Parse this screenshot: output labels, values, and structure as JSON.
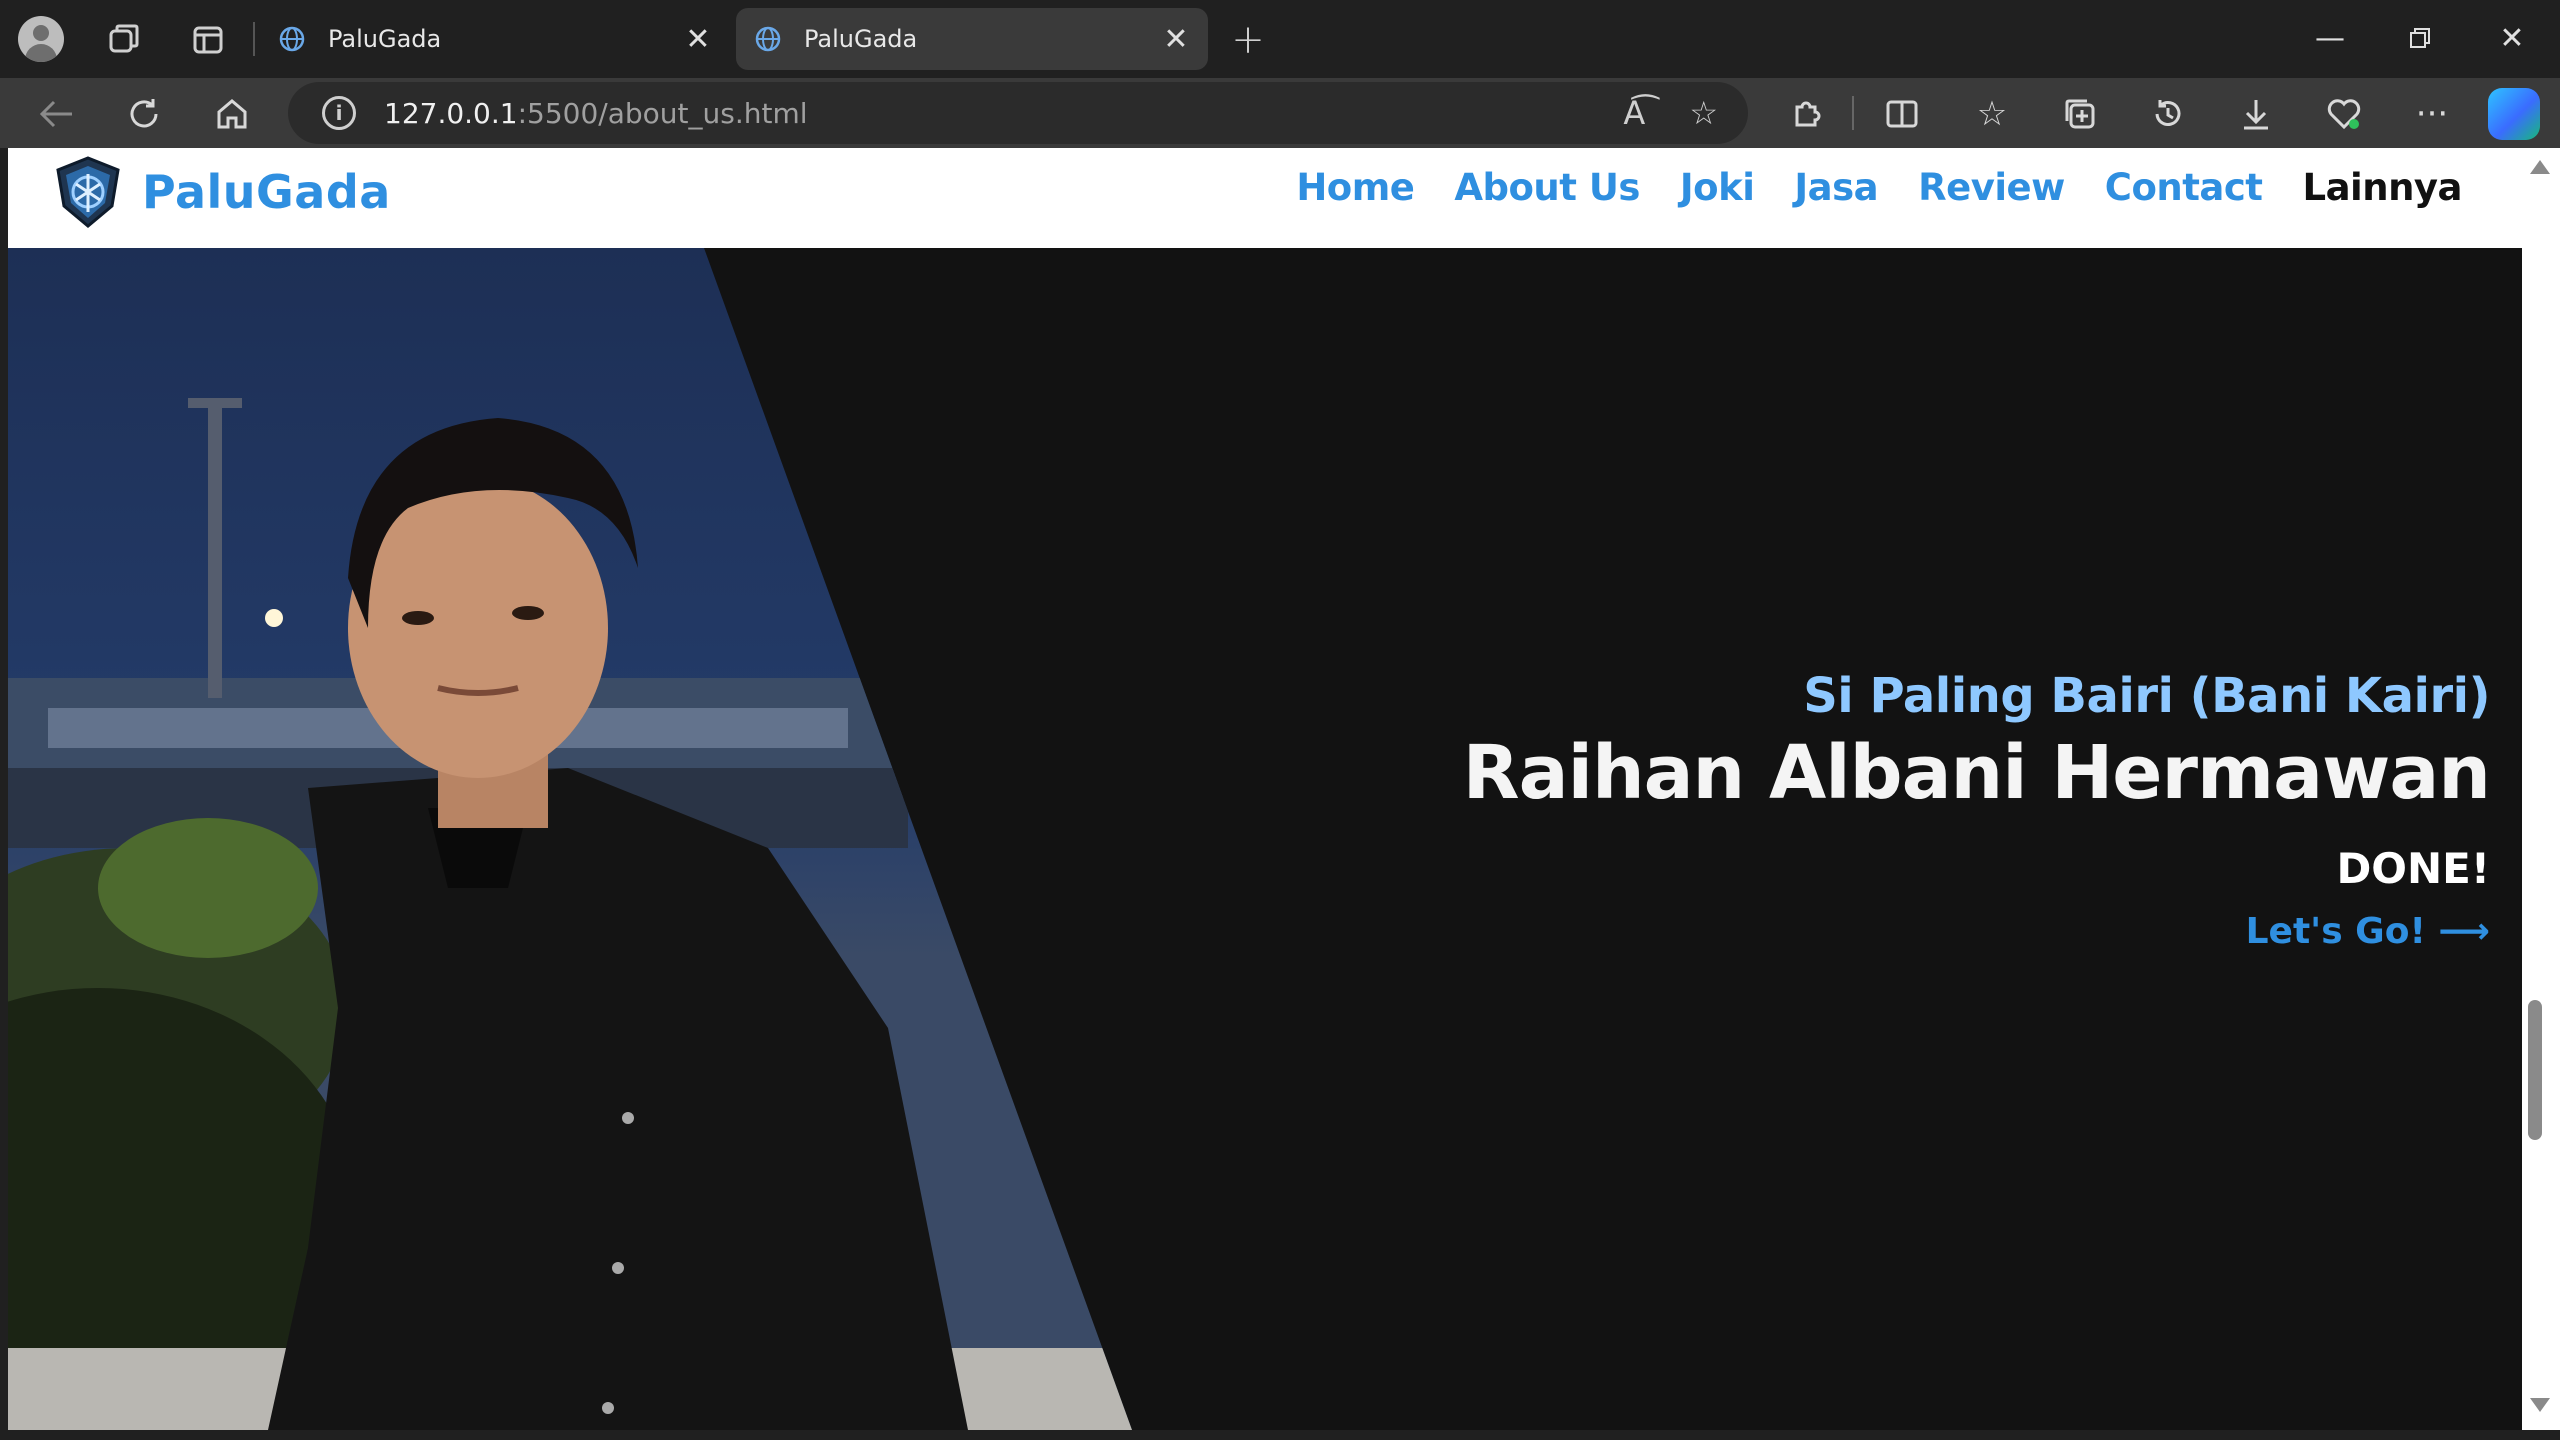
{
  "browser": {
    "tabs": [
      {
        "title": "PaluGada",
        "active": false
      },
      {
        "title": "PaluGada",
        "active": true
      }
    ],
    "address": {
      "host": "127.0.0.1",
      "path": ":5500/about_us.html"
    },
    "colors": {
      "chrome_bg": "#202020",
      "toolbar_bg": "#3a3a3a"
    }
  },
  "site": {
    "brand": "PaluGada",
    "nav": [
      {
        "label": "Home"
      },
      {
        "label": "About Us"
      },
      {
        "label": "Joki"
      },
      {
        "label": "Jasa"
      },
      {
        "label": "Review"
      },
      {
        "label": "Contact"
      },
      {
        "label": "Lainnya"
      }
    ],
    "colors": {
      "accent": "#2f8fe0",
      "accent_light": "#8ec8ff",
      "hero_bg": "#121212"
    }
  },
  "hero": {
    "subtitle": "Si Paling Bairi (Bani Kairi)",
    "name": "Raihan Albani Hermawan",
    "status": "DONE!",
    "cta": "Let's Go! ⟶"
  }
}
